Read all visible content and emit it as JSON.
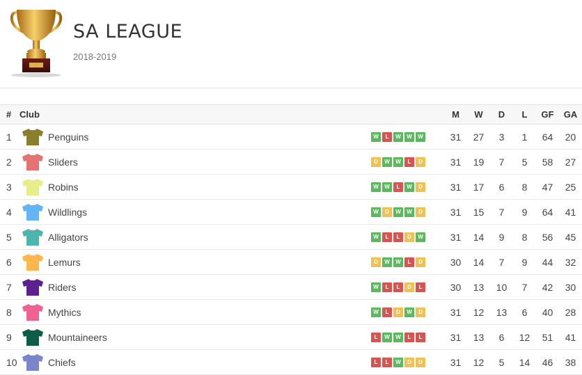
{
  "league": {
    "title": "SA LEAGUE",
    "season": "2018-2019"
  },
  "colors": {
    "win": "#5cb85c",
    "loss": "#d9534f",
    "draw": "#f0c050"
  },
  "table": {
    "headers": {
      "rank": "#",
      "club": "Club",
      "m": "M",
      "w": "W",
      "d": "D",
      "l": "L",
      "gf": "GF",
      "ga": "GA"
    },
    "rows": [
      {
        "rank": "1",
        "club": "Penguins",
        "shirt_color": "#8a7f2c",
        "form": [
          "W",
          "L",
          "W",
          "W",
          "W"
        ],
        "m": "31",
        "w": "27",
        "d": "3",
        "l": "1",
        "gf": "64",
        "ga": "20"
      },
      {
        "rank": "2",
        "club": "Sliders",
        "shirt_color": "#e57373",
        "form": [
          "D",
          "W",
          "W",
          "L",
          "D"
        ],
        "m": "31",
        "w": "19",
        "d": "7",
        "l": "5",
        "gf": "58",
        "ga": "27"
      },
      {
        "rank": "3",
        "club": "Robins",
        "shirt_color": "#e6ee8a",
        "form": [
          "W",
          "W",
          "L",
          "W",
          "D"
        ],
        "m": "31",
        "w": "17",
        "d": "6",
        "l": "8",
        "gf": "47",
        "ga": "25"
      },
      {
        "rank": "4",
        "club": "Wildlings",
        "shirt_color": "#64b5f6",
        "form": [
          "W",
          "D",
          "W",
          "W",
          "D"
        ],
        "m": "31",
        "w": "15",
        "d": "7",
        "l": "9",
        "gf": "64",
        "ga": "41"
      },
      {
        "rank": "5",
        "club": "Alligators",
        "shirt_color": "#4db6ac",
        "form": [
          "W",
          "L",
          "L",
          "D",
          "W"
        ],
        "m": "31",
        "w": "14",
        "d": "9",
        "l": "8",
        "gf": "56",
        "ga": "45"
      },
      {
        "rank": "6",
        "club": "Lemurs",
        "shirt_color": "#ffb74d",
        "form": [
          "D",
          "W",
          "W",
          "L",
          "D"
        ],
        "m": "30",
        "w": "14",
        "d": "7",
        "l": "9",
        "gf": "44",
        "ga": "32"
      },
      {
        "rank": "7",
        "club": "Riders",
        "shirt_color": "#5e1f8f",
        "form": [
          "W",
          "L",
          "L",
          "D",
          "L"
        ],
        "m": "30",
        "w": "13",
        "d": "10",
        "l": "7",
        "gf": "42",
        "ga": "30"
      },
      {
        "rank": "8",
        "club": "Mythics",
        "shirt_color": "#f06292",
        "form": [
          "W",
          "L",
          "D",
          "W",
          "D"
        ],
        "m": "31",
        "w": "12",
        "d": "13",
        "l": "6",
        "gf": "40",
        "ga": "28"
      },
      {
        "rank": "9",
        "club": "Mountaineers",
        "shirt_color": "#0d5c45",
        "form": [
          "L",
          "W",
          "W",
          "L",
          "L"
        ],
        "m": "31",
        "w": "13",
        "d": "6",
        "l": "12",
        "gf": "51",
        "ga": "41"
      },
      {
        "rank": "10",
        "club": "Chiefs",
        "shirt_color": "#7986cb",
        "form": [
          "L",
          "L",
          "W",
          "D",
          "D"
        ],
        "m": "31",
        "w": "12",
        "d": "5",
        "l": "14",
        "gf": "46",
        "ga": "38"
      }
    ]
  }
}
